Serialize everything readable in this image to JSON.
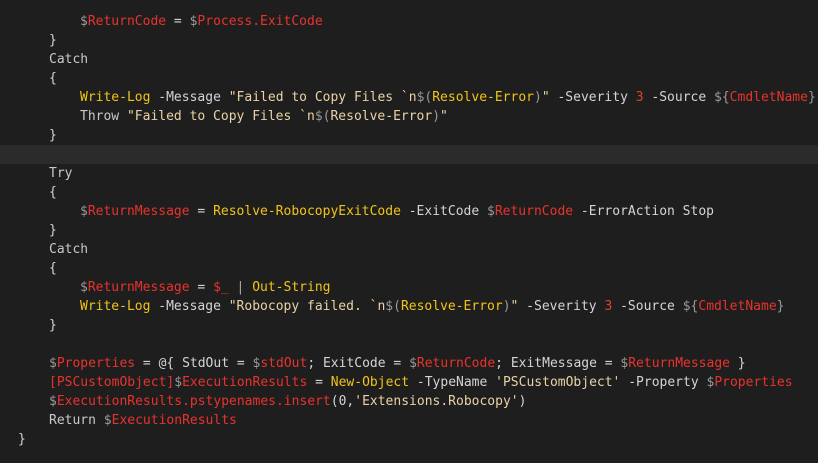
{
  "editor": {
    "lines": [
      {
        "indent": 2,
        "tokens": [
          {
            "t": "$",
            "c": "sigil"
          },
          {
            "t": "ReturnCode",
            "c": "var"
          },
          {
            "t": " = ",
            "c": "plain"
          },
          {
            "t": "$",
            "c": "sigil"
          },
          {
            "t": "Process.ExitCode",
            "c": "var"
          }
        ]
      },
      {
        "indent": 1,
        "tokens": [
          {
            "t": "}",
            "c": "plain"
          }
        ]
      },
      {
        "indent": 1,
        "tokens": [
          {
            "t": "Catch",
            "c": "kw"
          }
        ]
      },
      {
        "indent": 1,
        "tokens": [
          {
            "t": "{",
            "c": "plain"
          }
        ]
      },
      {
        "indent": 2,
        "tokens": [
          {
            "t": "Write-Log",
            "c": "cmd"
          },
          {
            "t": " -Message ",
            "c": "param"
          },
          {
            "t": "\"Failed to Copy Files `n",
            "c": "str"
          },
          {
            "t": "$(",
            "c": "sigil"
          },
          {
            "t": "Resolve-Error",
            "c": "cmd"
          },
          {
            "t": ")",
            "c": "sigil"
          },
          {
            "t": "\"",
            "c": "str"
          },
          {
            "t": " -Severity ",
            "c": "param"
          },
          {
            "t": "3",
            "c": "num"
          },
          {
            "t": " -Source ",
            "c": "param"
          },
          {
            "t": "${",
            "c": "sigil"
          },
          {
            "t": "CmdletName",
            "c": "var"
          },
          {
            "t": "}",
            "c": "sigil"
          }
        ]
      },
      {
        "indent": 2,
        "tokens": [
          {
            "t": "Throw ",
            "c": "kw"
          },
          {
            "t": "\"Failed to Copy Files `n",
            "c": "str"
          },
          {
            "t": "$(",
            "c": "sigil"
          },
          {
            "t": "Resolve-Error",
            "c": "str"
          },
          {
            "t": ")",
            "c": "sigil"
          },
          {
            "t": "\"",
            "c": "str"
          }
        ]
      },
      {
        "indent": 1,
        "tokens": [
          {
            "t": "}",
            "c": "plain"
          }
        ]
      },
      {
        "indent": 1,
        "current": true,
        "tokens": []
      },
      {
        "indent": 1,
        "tokens": [
          {
            "t": "Try",
            "c": "kw"
          }
        ]
      },
      {
        "indent": 1,
        "tokens": [
          {
            "t": "{",
            "c": "plain"
          }
        ]
      },
      {
        "indent": 2,
        "tokens": [
          {
            "t": "$",
            "c": "sigil"
          },
          {
            "t": "ReturnMessage",
            "c": "var"
          },
          {
            "t": " = ",
            "c": "plain"
          },
          {
            "t": "Resolve-RobocopyExitCode",
            "c": "cmd"
          },
          {
            "t": " -ExitCode ",
            "c": "param"
          },
          {
            "t": "$",
            "c": "sigil"
          },
          {
            "t": "ReturnCode",
            "c": "var"
          },
          {
            "t": " -ErrorAction Stop",
            "c": "param"
          }
        ]
      },
      {
        "indent": 1,
        "tokens": [
          {
            "t": "}",
            "c": "plain"
          }
        ]
      },
      {
        "indent": 1,
        "tokens": [
          {
            "t": "Catch",
            "c": "kw"
          }
        ]
      },
      {
        "indent": 1,
        "tokens": [
          {
            "t": "{",
            "c": "plain"
          }
        ]
      },
      {
        "indent": 2,
        "tokens": [
          {
            "t": "$",
            "c": "sigil"
          },
          {
            "t": "ReturnMessage",
            "c": "var"
          },
          {
            "t": " = ",
            "c": "plain"
          },
          {
            "t": "$_",
            "c": "var"
          },
          {
            "t": " | ",
            "c": "op"
          },
          {
            "t": "Out-String",
            "c": "cmd"
          }
        ]
      },
      {
        "indent": 2,
        "tokens": [
          {
            "t": "Write-Log",
            "c": "cmd"
          },
          {
            "t": " -Message ",
            "c": "param"
          },
          {
            "t": "\"Robocopy failed. `n",
            "c": "str"
          },
          {
            "t": "$(",
            "c": "sigil"
          },
          {
            "t": "Resolve-Error",
            "c": "cmd"
          },
          {
            "t": ")",
            "c": "sigil"
          },
          {
            "t": "\"",
            "c": "str"
          },
          {
            "t": " -Severity ",
            "c": "param"
          },
          {
            "t": "3",
            "c": "num"
          },
          {
            "t": " -Source ",
            "c": "param"
          },
          {
            "t": "${",
            "c": "sigil"
          },
          {
            "t": "CmdletName",
            "c": "var"
          },
          {
            "t": "}",
            "c": "sigil"
          }
        ]
      },
      {
        "indent": 1,
        "tokens": [
          {
            "t": "}",
            "c": "plain"
          }
        ]
      },
      {
        "indent": 1,
        "tokens": []
      },
      {
        "indent": 1,
        "tokens": [
          {
            "t": "$",
            "c": "sigil"
          },
          {
            "t": "Properties",
            "c": "var"
          },
          {
            "t": " = @{ StdOut = ",
            "c": "plain"
          },
          {
            "t": "$",
            "c": "sigil"
          },
          {
            "t": "stdOut",
            "c": "var"
          },
          {
            "t": "; ExitCode = ",
            "c": "plain"
          },
          {
            "t": "$",
            "c": "sigil"
          },
          {
            "t": "ReturnCode",
            "c": "var"
          },
          {
            "t": "; ExitMessage = ",
            "c": "plain"
          },
          {
            "t": "$",
            "c": "sigil"
          },
          {
            "t": "ReturnMessage",
            "c": "var"
          },
          {
            "t": " }",
            "c": "plain"
          }
        ]
      },
      {
        "indent": 1,
        "tokens": [
          {
            "t": "[PSCustomObject]",
            "c": "type"
          },
          {
            "t": "$",
            "c": "sigil"
          },
          {
            "t": "ExecutionResults",
            "c": "var"
          },
          {
            "t": " = ",
            "c": "plain"
          },
          {
            "t": "New-Object",
            "c": "cmd"
          },
          {
            "t": " -TypeName ",
            "c": "param"
          },
          {
            "t": "'PSCustomObject'",
            "c": "str"
          },
          {
            "t": " -Property ",
            "c": "param"
          },
          {
            "t": "$",
            "c": "sigil"
          },
          {
            "t": "Properties",
            "c": "var"
          }
        ]
      },
      {
        "indent": 1,
        "tokens": [
          {
            "t": "$",
            "c": "sigil"
          },
          {
            "t": "ExecutionResults.pstypenames.insert",
            "c": "var"
          },
          {
            "t": "(0,",
            "c": "plain"
          },
          {
            "t": "'Extensions.Robocopy'",
            "c": "str"
          },
          {
            "t": ")",
            "c": "plain"
          }
        ]
      },
      {
        "indent": 1,
        "tokens": [
          {
            "t": "Return ",
            "c": "kw"
          },
          {
            "t": "$",
            "c": "sigil"
          },
          {
            "t": "ExecutionResults",
            "c": "var"
          }
        ]
      },
      {
        "indent": 0,
        "tokens": [
          {
            "t": "}",
            "c": "plain"
          }
        ]
      }
    ]
  }
}
